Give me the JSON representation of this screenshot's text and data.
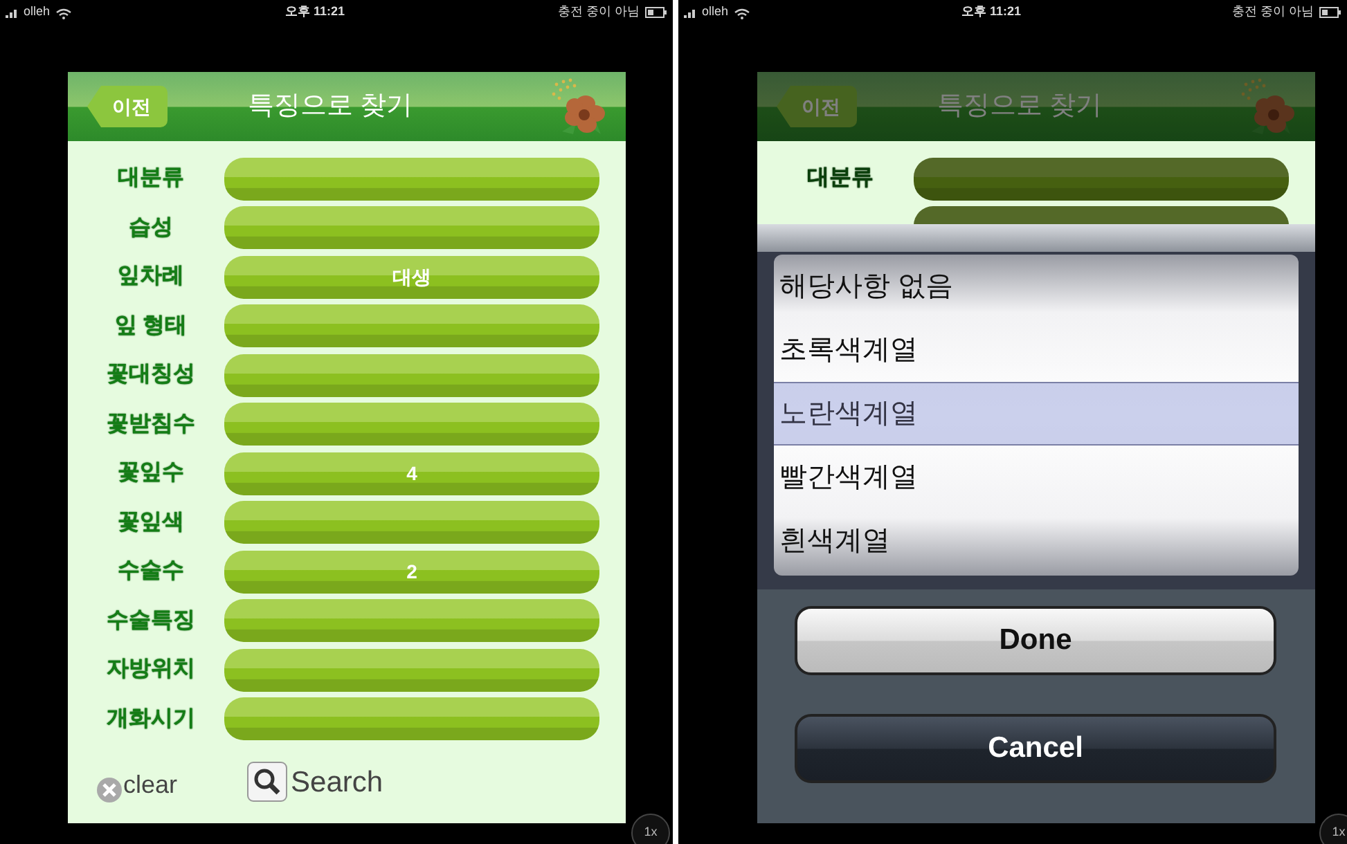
{
  "screens": [
    {
      "status_bar": {
        "carrier": "olleh",
        "time": "오후 11:21",
        "battery": "충전 중이 아님"
      },
      "header": {
        "back": "이전",
        "title": "특징으로 찾기"
      },
      "dimmed": false,
      "fields": [
        {
          "label": "대분류"
        },
        {
          "label": "습성"
        },
        {
          "label": "잎차례",
          "value": "대생"
        },
        {
          "label": "잎 형태"
        },
        {
          "label": "꽃대칭성"
        },
        {
          "label": "꽃받침수"
        },
        {
          "label": "꽃잎수",
          "value": "4"
        },
        {
          "label": "꽃잎색"
        },
        {
          "label": "수술수",
          "value": "2"
        },
        {
          "label": "수술특징"
        },
        {
          "label": "자방위치"
        },
        {
          "label": "개화시기"
        }
      ],
      "clear": "clear",
      "search": "Search",
      "zoom": "1x"
    },
    {
      "status_bar": {
        "carrier": "olleh",
        "time": "오후 11:21",
        "battery": "충전 중이 아님"
      },
      "header": {
        "back": "이전",
        "title": "특징으로 찾기"
      },
      "dimmed": true,
      "fields": [
        {
          "label": "대분류"
        }
      ],
      "picker": {
        "options": [
          {
            "label": "해당사항 없음",
            "selected": false
          },
          {
            "label": "초록색계열",
            "selected": false
          },
          {
            "label": "노란색계열",
            "selected": true
          },
          {
            "label": "빨간색계열",
            "selected": false
          },
          {
            "label": "흰색계열",
            "selected": false
          }
        ],
        "buttons": [
          {
            "label": "Done",
            "kind": "light"
          },
          {
            "label": "Cancel",
            "kind": "dark"
          }
        ]
      },
      "zoom": "1x"
    }
  ]
}
